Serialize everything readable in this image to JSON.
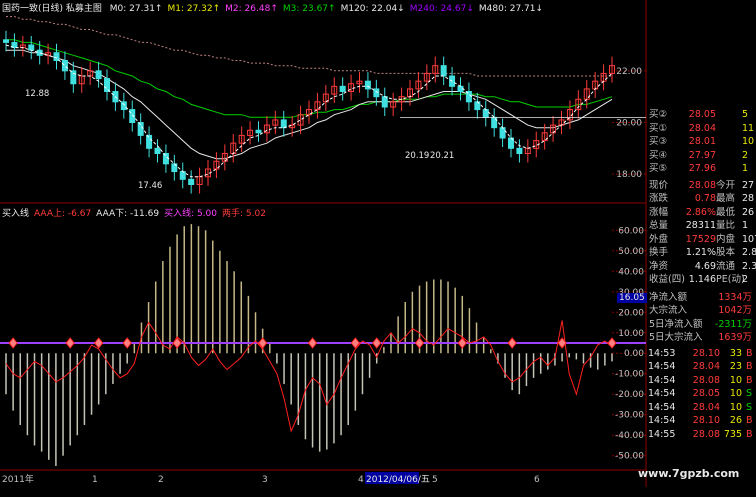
{
  "window": {
    "title": "国药一致(日线) 私募主图"
  },
  "ma_legend": [
    {
      "label": "M0: 27.31",
      "color": "#e8e8e8",
      "arrow": "↑"
    },
    {
      "label": "M1: 27.32",
      "color": "#e8e800",
      "arrow": "↑"
    },
    {
      "label": "M2: 26.48",
      "color": "#ff40ff",
      "arrow": "↑"
    },
    {
      "label": "M3: 23.67",
      "color": "#00d000",
      "arrow": "↑"
    },
    {
      "label": "M120: 22.04",
      "color": "#e8e8e8",
      "arrow": "↓"
    },
    {
      "label": "M240: 24.67",
      "color": "#a000ff",
      "arrow": "↓"
    },
    {
      "label": "M480: 27.71",
      "color": "#e8e8e8",
      "arrow": "↓"
    }
  ],
  "indicator_legend": [
    {
      "label": "买入线",
      "color": "#e8e8e8"
    },
    {
      "label": "AAA上: -6.67",
      "color": "#ff3b3b"
    },
    {
      "label": "AAA下: -11.69",
      "color": "#e8e8e8"
    },
    {
      "label": "买入线: 5.00",
      "color": "#ff40ff"
    },
    {
      "label": "两手: 5.02",
      "color": "#ff3b3b"
    }
  ],
  "chart_data": {
    "type": "line",
    "main": {
      "yticks": [
        "22.00",
        "20.00",
        "18.00"
      ],
      "ylim": [
        17.0,
        24.2
      ],
      "annotations": [
        "12.88",
        "17.46",
        "20.19",
        "20.21"
      ],
      "close": [
        23.1,
        22.9,
        23.0,
        22.8,
        22.6,
        22.7,
        22.4,
        22.0,
        21.5,
        21.8,
        22.0,
        21.7,
        21.2,
        20.8,
        20.5,
        20.0,
        19.5,
        19.0,
        18.8,
        18.4,
        18.1,
        17.8,
        17.6,
        17.9,
        18.2,
        18.5,
        18.8,
        19.2,
        19.5,
        19.7,
        19.6,
        19.9,
        20.1,
        19.8,
        19.9,
        20.3,
        20.5,
        20.8,
        21.1,
        21.4,
        21.2,
        21.5,
        21.6,
        21.3,
        21.0,
        20.6,
        20.8,
        21.0,
        21.3,
        21.6,
        21.9,
        22.2,
        21.8,
        21.4,
        21.2,
        20.8,
        20.5,
        20.2,
        19.8,
        19.4,
        19.0,
        18.8,
        19.0,
        19.3,
        19.6,
        19.9,
        20.1,
        20.5,
        20.9,
        21.3,
        21.6,
        21.9,
        22.2
      ],
      "ma_short": [
        23.0,
        22.9,
        22.9,
        22.8,
        22.7,
        22.6,
        22.5,
        22.2,
        21.9,
        21.8,
        21.8,
        21.6,
        21.3,
        21.0,
        20.7,
        20.3,
        19.9,
        19.4,
        19.1,
        18.7,
        18.4,
        18.1,
        17.9,
        17.9,
        18.0,
        18.2,
        18.5,
        18.8,
        19.1,
        19.4,
        19.5,
        19.7,
        19.8,
        19.8,
        19.9,
        20.1,
        20.3,
        20.5,
        20.8,
        21.0,
        21.1,
        21.3,
        21.4,
        21.4,
        21.2,
        21.0,
        20.9,
        20.9,
        21.0,
        21.2,
        21.5,
        21.8,
        21.8,
        21.6,
        21.4,
        21.1,
        20.8,
        20.5,
        20.2,
        19.8,
        19.4,
        19.1,
        19.0,
        19.1,
        19.3,
        19.6,
        19.9,
        20.2,
        20.6,
        20.9,
        21.3,
        21.6,
        21.9
      ],
      "ma_mid": [
        22.8,
        22.8,
        22.8,
        22.7,
        22.7,
        22.6,
        22.5,
        22.4,
        22.2,
        22.1,
        22.0,
        21.9,
        21.7,
        21.5,
        21.3,
        21.0,
        20.8,
        20.5,
        20.2,
        19.9,
        19.6,
        19.3,
        19.0,
        18.8,
        18.7,
        18.6,
        18.6,
        18.7,
        18.8,
        19.0,
        19.1,
        19.2,
        19.4,
        19.5,
        19.6,
        19.7,
        19.8,
        20.0,
        20.1,
        20.3,
        20.4,
        20.5,
        20.7,
        20.8,
        20.8,
        20.8,
        20.8,
        20.8,
        20.8,
        20.9,
        21.0,
        21.1,
        21.2,
        21.2,
        21.2,
        21.1,
        21.0,
        20.9,
        20.7,
        20.5,
        20.3,
        20.1,
        19.9,
        19.8,
        19.8,
        19.8,
        19.9,
        20.0,
        20.1,
        20.3,
        20.5,
        20.7,
        20.9
      ],
      "ma_long": [
        23.2,
        23.2,
        23.1,
        23.1,
        23.0,
        22.9,
        22.8,
        22.7,
        22.6,
        22.5,
        22.4,
        22.3,
        22.2,
        22.0,
        21.9,
        21.8,
        21.6,
        21.5,
        21.3,
        21.2,
        21.0,
        20.9,
        20.7,
        20.6,
        20.5,
        20.4,
        20.3,
        20.3,
        20.3,
        20.2,
        20.2,
        20.2,
        20.2,
        20.2,
        20.2,
        20.3,
        20.3,
        20.4,
        20.4,
        20.5,
        20.5,
        20.6,
        20.7,
        20.7,
        20.8,
        20.8,
        20.8,
        20.9,
        20.9,
        20.9,
        21.0,
        21.0,
        21.1,
        21.1,
        21.1,
        21.1,
        21.1,
        21.0,
        21.0,
        20.9,
        20.8,
        20.8,
        20.7,
        20.6,
        20.6,
        20.6,
        20.6,
        20.6,
        20.7,
        20.7,
        20.8,
        20.9,
        21.0
      ],
      "ma_far": [
        24.1,
        24.1,
        24.0,
        24.0,
        23.9,
        23.9,
        23.8,
        23.8,
        23.7,
        23.6,
        23.6,
        23.5,
        23.4,
        23.4,
        23.3,
        23.2,
        23.1,
        23.1,
        23.0,
        22.9,
        22.8,
        22.8,
        22.7,
        22.6,
        22.6,
        22.5,
        22.5,
        22.4,
        22.4,
        22.3,
        22.3,
        22.3,
        22.2,
        22.2,
        22.2,
        22.1,
        22.1,
        22.1,
        22.1,
        22.0,
        22.0,
        22.0,
        22.0,
        22.0,
        21.9,
        21.9,
        21.9,
        21.9,
        21.9,
        21.9,
        21.9,
        21.9,
        21.9,
        21.9,
        21.9,
        21.9,
        21.8,
        21.8,
        21.8,
        21.8,
        21.8,
        21.8,
        21.8,
        21.8,
        21.8,
        21.8,
        21.8,
        21.8,
        21.8,
        21.8,
        21.8,
        21.8,
        21.8
      ]
    },
    "sub": {
      "yticks": [
        "60.00",
        "50.00",
        "40.00",
        "30.00",
        "20.00",
        "10.00",
        "0.00",
        "-10.00",
        "-20.00",
        "-30.00",
        "-40.00",
        "-50.00"
      ],
      "ylim": [
        -56,
        66
      ],
      "buy_line": 5.0,
      "bars": [
        -20,
        -28,
        -35,
        -40,
        -45,
        -48,
        -52,
        -55,
        -50,
        -45,
        -40,
        -35,
        -30,
        -25,
        -20,
        -15,
        -10,
        -5,
        5,
        15,
        25,
        35,
        45,
        52,
        58,
        62,
        63,
        62,
        60,
        55,
        50,
        45,
        40,
        35,
        28,
        20,
        12,
        5,
        -5,
        -15,
        -25,
        -35,
        -42,
        -46,
        -48,
        -47,
        -44,
        -40,
        -35,
        -28,
        -20,
        -12,
        -5,
        3,
        10,
        18,
        25,
        30,
        33,
        35,
        36,
        36,
        35,
        32,
        28,
        22,
        15,
        8,
        2,
        -5,
        -12,
        -18,
        -20,
        -16,
        -12,
        -10,
        -8,
        -6,
        -4,
        -2,
        -3,
        -5,
        -7,
        -8,
        -6,
        -4
      ],
      "aaa_line": [
        -5,
        -10,
        -12,
        -8,
        -4,
        -6,
        -10,
        -14,
        -12,
        -9,
        -6,
        -2,
        4,
        2,
        -3,
        -8,
        -12,
        -10,
        -5,
        8,
        15,
        10,
        4,
        2,
        8,
        5,
        -2,
        -6,
        -3,
        2,
        -4,
        -8,
        -5,
        -2,
        3,
        6,
        2,
        -4,
        -10,
        -22,
        -38,
        -30,
        -18,
        -12,
        -15,
        -25,
        -20,
        -12,
        -5,
        2,
        6,
        4,
        -2,
        6,
        10,
        5,
        8,
        12,
        10,
        6,
        4,
        8,
        12,
        10,
        8,
        5,
        6,
        8,
        4,
        -4,
        -10,
        -14,
        -12,
        -8,
        -4,
        -2,
        -6,
        -2,
        16,
        -10,
        -20,
        -6,
        -2,
        4,
        6,
        3
      ],
      "markers": [
        1,
        9,
        13,
        17,
        24,
        36,
        43,
        49,
        52,
        58,
        64,
        71,
        78,
        85
      ]
    },
    "xticks": [
      "2011年",
      "1",
      "2",
      "3",
      "4",
      "2012/04/06/五",
      "5",
      "6"
    ]
  },
  "quote_panel": {
    "order_book": [
      {
        "label": "买②",
        "price": "28.05",
        "vol": "5"
      },
      {
        "label": "买①",
        "price": "28.04",
        "vol": "11"
      },
      {
        "label": "买③",
        "price": "28.01",
        "vol": "10"
      },
      {
        "label": "买④",
        "price": "27.97",
        "vol": "2"
      },
      {
        "label": "买⑤",
        "price": "27.96",
        "vol": "1"
      }
    ],
    "stats": [
      {
        "k1": "现价",
        "v1": "28.08",
        "c1": "red",
        "k2": "今开",
        "v2": "27"
      },
      {
        "k1": "涨跌",
        "v1": "0.78",
        "c1": "red",
        "k2": "最高",
        "v2": "28"
      },
      {
        "k1": "涨幅",
        "v1": "2.86%",
        "c1": "red",
        "k2": "最低",
        "v2": "26"
      },
      {
        "k1": "总量",
        "v1": "28311",
        "c1": "white",
        "k2": "量比",
        "v2": "1"
      },
      {
        "k1": "外盘",
        "v1": "17529",
        "c1": "red",
        "k2": "内盘",
        "v2": "107"
      },
      {
        "k1": "换手",
        "v1": "1.21%",
        "c1": "white",
        "k2": "股本",
        "v2": "2.8"
      },
      {
        "k1": "净资",
        "v1": "4.69",
        "c1": "white",
        "k2": "流通",
        "v2": "2.3"
      },
      {
        "k1": "收益(四)",
        "v1": "1.146",
        "c1": "white",
        "k2": "PE(动)",
        "v2": "2"
      }
    ],
    "flows": [
      {
        "k": "净流入额",
        "v": "1334万",
        "c": "red"
      },
      {
        "k": "大宗流入",
        "v": "1042万",
        "c": "red"
      },
      {
        "k": "5日净流入额",
        "v": "-2311万",
        "c": "green"
      },
      {
        "k": "5日大宗流入",
        "v": "1639万",
        "c": "red"
      }
    ],
    "ticks": [
      {
        "t": "14:53",
        "p": "28.10",
        "v": "33",
        "s": "B"
      },
      {
        "t": "14:54",
        "p": "28.04",
        "v": "23",
        "s": "B"
      },
      {
        "t": "14:54",
        "p": "28.08",
        "v": "10",
        "s": "B"
      },
      {
        "t": "14:54",
        "p": "28.05",
        "v": "10",
        "s": "S"
      },
      {
        "t": "14:54",
        "p": "28.04",
        "v": "10",
        "s": "S"
      },
      {
        "t": "14:54",
        "p": "28.10",
        "v": "26",
        "s": "B"
      },
      {
        "t": "14:55",
        "p": "28.08",
        "v": "735",
        "s": "B"
      }
    ],
    "side_label": "16.05"
  },
  "watermark": "www.7gpzb.com"
}
